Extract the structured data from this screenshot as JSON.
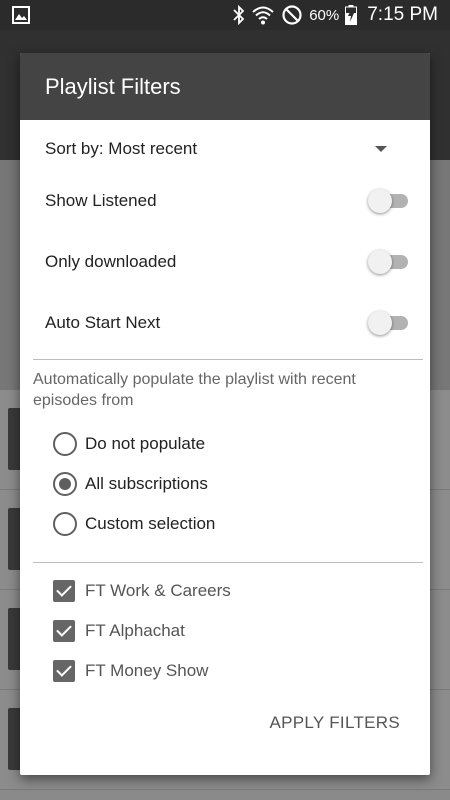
{
  "status_bar": {
    "battery_percent": "60%",
    "time": "7:15 PM",
    "icons": [
      "gallery-icon",
      "bluetooth-icon",
      "wifi-icon",
      "do-not-disturb-icon",
      "battery-charging-icon"
    ]
  },
  "dialog": {
    "title": "Playlist Filters",
    "sort_label": "Sort by: Most recent",
    "toggles": [
      {
        "label": "Show Listened",
        "on": false
      },
      {
        "label": "Only downloaded",
        "on": false
      },
      {
        "label": "Auto Start Next",
        "on": false
      }
    ],
    "populate_description": "Automatically populate the playlist with recent episodes from",
    "radio_options": [
      {
        "label": "Do not populate",
        "selected": false
      },
      {
        "label": "All subscriptions",
        "selected": true
      },
      {
        "label": "Custom selection",
        "selected": false
      }
    ],
    "subscriptions": [
      {
        "label": "FT Work & Careers",
        "checked": true
      },
      {
        "label": "FT Alphachat",
        "checked": true
      },
      {
        "label": "FT Money Show",
        "checked": true
      }
    ],
    "apply_button": "APPLY FILTERS"
  },
  "colors": {
    "dialog_header": "#444444",
    "status_bar": "#2b2b2b",
    "control_gray": "#5f5f5f"
  }
}
